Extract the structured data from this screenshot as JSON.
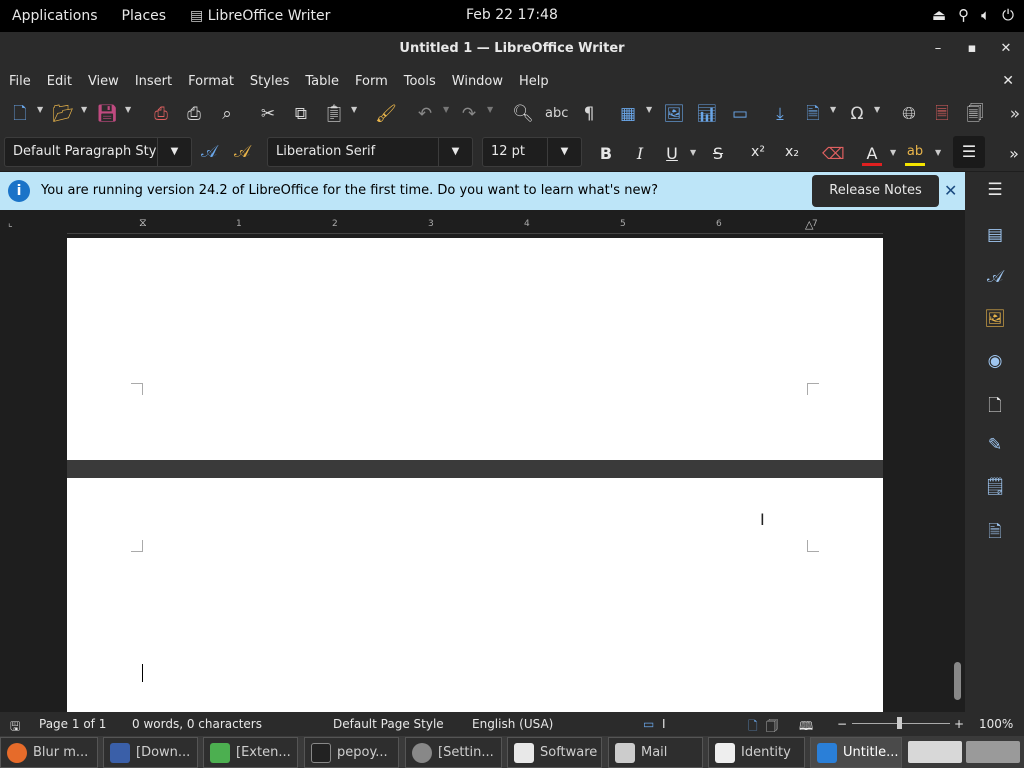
{
  "topbar": {
    "applications": "Applications",
    "places": "Places",
    "app_name": "LibreOffice Writer",
    "clock": "Feb 22  17:48"
  },
  "window": {
    "title": "Untitled 1 — LibreOffice Writer"
  },
  "menu": [
    "File",
    "Edit",
    "View",
    "Insert",
    "Format",
    "Styles",
    "Table",
    "Form",
    "Tools",
    "Window",
    "Help"
  ],
  "format_toolbar": {
    "paragraph_style": "Default Paragraph Sty",
    "font_name": "Liberation Serif",
    "font_size": "12 pt",
    "bold": "B",
    "italic": "I",
    "underline": "U",
    "strikethrough": "S",
    "superscript": "x²",
    "subscript": "x₂"
  },
  "infobar": {
    "message": "You are running version 24.2 of LibreOffice for the first time. Do you want to learn what's new?",
    "button": "Release Notes"
  },
  "ruler": [
    "1",
    "2",
    "3",
    "4",
    "5",
    "6",
    "7"
  ],
  "statusbar": {
    "page": "Page 1 of 1",
    "words": "0 words, 0 characters",
    "page_style": "Default Page Style",
    "language": "English (USA)",
    "zoom": "100%"
  },
  "taskbar": [
    {
      "label": "Blur m...",
      "color": "#e66b2a"
    },
    {
      "label": "[Down...",
      "color": "#3a5fa8"
    },
    {
      "label": "[Exten...",
      "color": "#4caf50"
    },
    {
      "label": "pepoy...",
      "color": "#222222"
    },
    {
      "label": "[Settin...",
      "color": "#888888"
    },
    {
      "label": "Software",
      "color": "#e8e8e8"
    },
    {
      "label": "Mail",
      "color": "#cccccc"
    },
    {
      "label": "Identity",
      "color": "#eeeeee"
    },
    {
      "label": "Untitle...",
      "color": "#2a7fd8"
    }
  ],
  "colors": {
    "infobar_bg": "#bde5f8",
    "accent": "#1a73c8",
    "font_color": "#e02020",
    "highlight": "#f5e400"
  }
}
